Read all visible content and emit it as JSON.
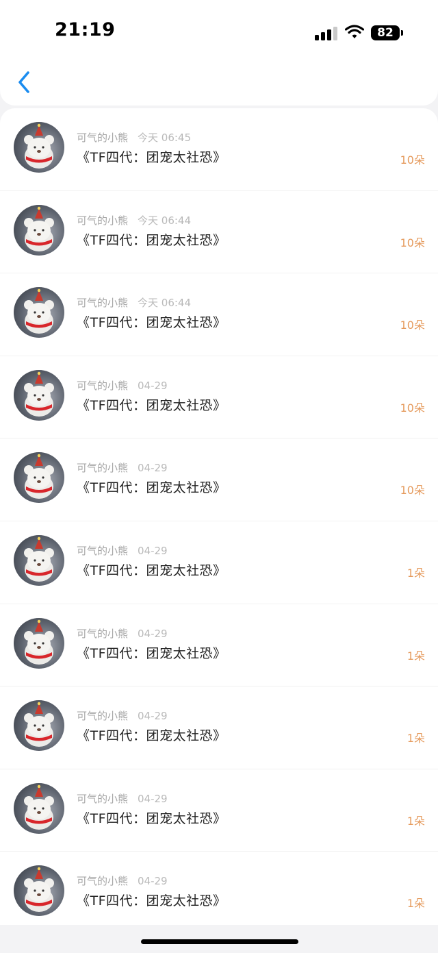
{
  "status_bar": {
    "time": "21:19",
    "battery": "82"
  },
  "colors": {
    "accent_blue": "#1a8cf0",
    "amount_orange": "#e59a5c",
    "meta_gray": "#a6a6a6"
  },
  "icons": {
    "back": "chevron-left-icon",
    "signal": "cellular-signal-icon",
    "wifi": "wifi-icon"
  },
  "items": [
    {
      "user": "可气的小熊",
      "date": "今天 06:45",
      "title": "《TF四代：团宠太社恐》",
      "amount": "10朵"
    },
    {
      "user": "可气的小熊",
      "date": "今天 06:44",
      "title": "《TF四代：团宠太社恐》",
      "amount": "10朵"
    },
    {
      "user": "可气的小熊",
      "date": "今天 06:44",
      "title": "《TF四代：团宠太社恐》",
      "amount": "10朵"
    },
    {
      "user": "可气的小熊",
      "date": "04-29",
      "title": "《TF四代：团宠太社恐》",
      "amount": "10朵"
    },
    {
      "user": "可气的小熊",
      "date": "04-29",
      "title": "《TF四代：团宠太社恐》",
      "amount": "10朵"
    },
    {
      "user": "可气的小熊",
      "date": "04-29",
      "title": "《TF四代：团宠太社恐》",
      "amount": "1朵"
    },
    {
      "user": "可气的小熊",
      "date": "04-29",
      "title": "《TF四代：团宠太社恐》",
      "amount": "1朵"
    },
    {
      "user": "可气的小熊",
      "date": "04-29",
      "title": "《TF四代：团宠太社恐》",
      "amount": "1朵"
    },
    {
      "user": "可气的小熊",
      "date": "04-29",
      "title": "《TF四代：团宠太社恐》",
      "amount": "1朵"
    },
    {
      "user": "可气的小熊",
      "date": "04-29",
      "title": "《TF四代：团宠太社恐》",
      "amount": "1朵"
    }
  ]
}
